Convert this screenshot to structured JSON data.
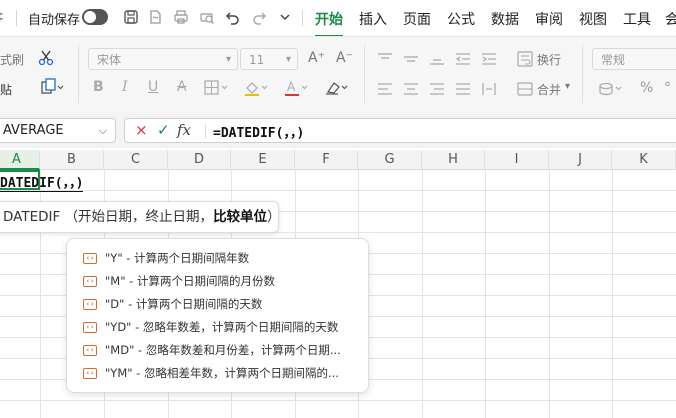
{
  "menubar": {
    "left_fragment": "‡",
    "autosave_label": "自动保存",
    "tabs": [
      {
        "label": "开始",
        "active": true
      },
      {
        "label": "插入"
      },
      {
        "label": "页面"
      },
      {
        "label": "公式"
      },
      {
        "label": "数据"
      },
      {
        "label": "审阅"
      },
      {
        "label": "视图"
      },
      {
        "label": "工具"
      },
      {
        "label": "会"
      }
    ]
  },
  "ribbon": {
    "format_painter": "式刷",
    "paste": "贴",
    "font_name": "宋体",
    "font_size": "11",
    "wrap": "换行",
    "merge": "合并",
    "number_format": "常规",
    "percent": "%"
  },
  "formula_bar": {
    "name_box": "AVERAGE",
    "cancel": "×",
    "confirm": "✓",
    "fx": "fx",
    "formula": "=DATEDIF(，，)"
  },
  "columns": [
    "A",
    "B",
    "C",
    "D",
    "E",
    "F",
    "G",
    "H",
    "I",
    "J",
    "K"
  ],
  "cell_a1": "DATEDIF(，，)",
  "tooltip": {
    "func": "DATEDIF",
    "open": "（开始日期，终止日期，",
    "current": "比较单位",
    "close": "）"
  },
  "suggestions": [
    "\"Y\" - 计算两个日期间隔年数",
    "\"M\" - 计算两个日期间隔的月份数",
    "\"D\" - 计算两个日期间隔的天数",
    "\"YD\" - 忽略年数差，计算两个日期间隔的天数",
    "\"MD\" - 忽略年数差和月份差，计算两个日期...",
    "\"YM\" - 忽略相差年数，计算两个日期间隔的..."
  ],
  "colors": {
    "accent": "#1a8a47",
    "cancel": "#dd3333",
    "suggestion_icon": "#d46b2e"
  }
}
